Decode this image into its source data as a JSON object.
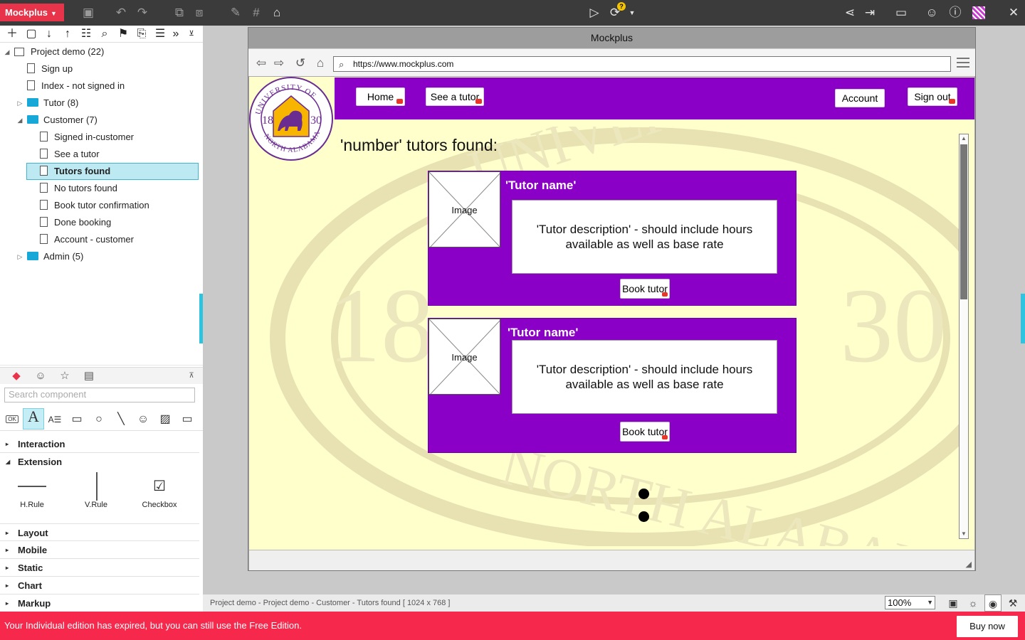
{
  "app": {
    "brand": "Mockplus",
    "brand_arrow": "▼",
    "colors": {
      "brand": "#e8344a",
      "accent": "#2ec4df",
      "page_purple": "#8a00c7",
      "page_bg": "#ffffcc",
      "banner": "#f6284b"
    }
  },
  "toolbar_icons": [
    "save-icon",
    "undo-icon",
    "redo-icon",
    "group-icon",
    "ungroup-icon",
    "format-painter-icon",
    "grid-icon",
    "fill-icon",
    "play-icon",
    "sync-icon",
    "share-icon",
    "export-icon",
    "fullscreen-icon",
    "user-icon",
    "help-icon",
    "qr-icon",
    "close-icon"
  ],
  "sync_badge": "?",
  "tree": {
    "root": "Project demo (22)",
    "items": [
      {
        "label": "Sign up"
      },
      {
        "label": "Index - not signed in"
      },
      {
        "label": "Tutor (8)"
      },
      {
        "label": "Customer (7)"
      },
      {
        "label": "Signed in-customer"
      },
      {
        "label": "See a tutor"
      },
      {
        "label": "Tutors found"
      },
      {
        "label": "No tutors found"
      },
      {
        "label": "Book tutor confirmation"
      },
      {
        "label": "Done booking"
      },
      {
        "label": "Account - customer"
      },
      {
        "label": "Admin (5)"
      }
    ]
  },
  "components": {
    "search_placeholder": "Search component",
    "ok_label": "OK",
    "sections": [
      "Interaction",
      "Extension",
      "Layout",
      "Mobile",
      "Static",
      "Chart",
      "Markup"
    ],
    "extension_items": [
      "H.Rule",
      "V.Rule",
      "Checkbox"
    ]
  },
  "frame": {
    "title": "Mockplus",
    "url": "https://www.mockplus.com"
  },
  "mock_page": {
    "nav": {
      "home": "Home",
      "see_tutor": "See a tutor",
      "account": "Account",
      "sign_out": "Sign out"
    },
    "seal_text": {
      "top": "UNIVERSITY OF",
      "bottom": "NORTH ALABAMA",
      "left_year": "18",
      "right_year": "30"
    },
    "heading": "'number' tutors found:",
    "cards": [
      {
        "image": "Image",
        "name": "'Tutor name'",
        "description": "'Tutor description' - should include hours available as well as base rate",
        "button": "Book tutor"
      },
      {
        "image": "Image",
        "name": "'Tutor name'",
        "description": "'Tutor description' - should include hours available as well as base rate",
        "button": "Book tutor"
      }
    ]
  },
  "breadcrumb": "Project demo - Project demo - Customer - Tutors found [ 1024 x 768 ]",
  "zoom": "100%",
  "banner": {
    "message": "Your Individual edition has expired, but you can still use the Free Edition.",
    "buy": "Buy now"
  }
}
